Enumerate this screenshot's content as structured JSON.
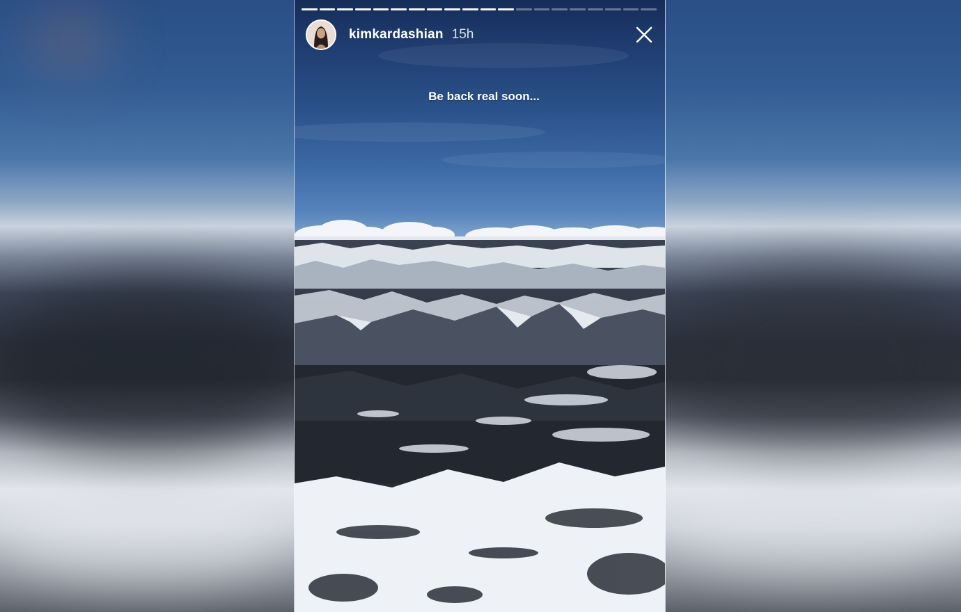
{
  "story": {
    "username": "kimkardashian",
    "time_ago": "15h",
    "caption": "Be back real soon...",
    "progress": {
      "segments_total": 20,
      "segments_done": 12
    }
  },
  "icons": {
    "close": "close-icon",
    "avatar": "avatar"
  },
  "colors": {
    "text": "#ffffff",
    "sky_top": "#152d5a",
    "sky_bottom": "#7ea2cc",
    "snow": "#e9edf2",
    "rock": "#2a2f38"
  }
}
